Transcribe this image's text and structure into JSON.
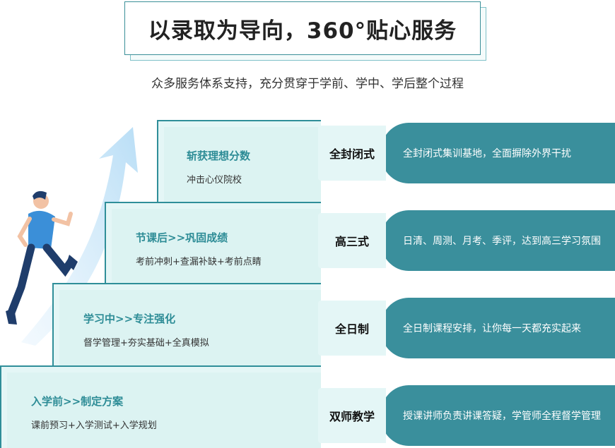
{
  "header": {
    "title": "以录取为导向，360°贴心服务",
    "subtitle": "众多服务体系支持，充分贯穿于学前、学中、学后整个过程"
  },
  "steps": [
    {
      "title": "斩获理想分数",
      "desc": "冲击心仪院校"
    },
    {
      "title": "节课后>>巩固成绩",
      "desc": "考前冲刺+查漏补缺+考前点睛"
    },
    {
      "title": "学习中>>专注强化",
      "desc": "督学管理+夯实基础+全真模拟"
    },
    {
      "title": "入学前>>制定方案",
      "desc": "课前预习+入学测试+入学规划"
    }
  ],
  "services": [
    {
      "label": "全封闭式",
      "desc": "全封闭式集训基地，全面摒除外界干扰"
    },
    {
      "label": "高三式",
      "desc": "日清、周测、月考、季评，达到高三学习氛围"
    },
    {
      "label": "全日制",
      "desc": "全日制课程安排，让你每一天都充实起来"
    },
    {
      "label": "双师教学",
      "desc": "授课讲师负责讲课答疑，学管师全程督学管理"
    }
  ],
  "colors": {
    "teal": "#3a8f9c",
    "light_teal": "#e4f6f6",
    "title_teal": "#2d8c96"
  }
}
